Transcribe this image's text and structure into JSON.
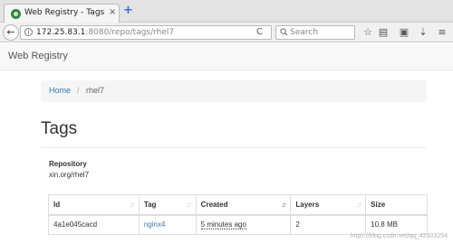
{
  "browser": {
    "tab_title": "Web Registry - Tags",
    "tab_close": "×",
    "new_tab": "+",
    "back": "←",
    "url_host": "172.25.83.1",
    "url_rest": ":8080/repo/tags/rhel7",
    "reload": "C",
    "search_placeholder": "Search",
    "toolbar_icons": [
      "star-icon",
      "reading-list-icon",
      "lock-icon",
      "download-icon",
      "menu-icon"
    ]
  },
  "app": {
    "brand": "Web Registry"
  },
  "breadcrumb": {
    "home": "Home",
    "separator": "/",
    "current": "rhel7"
  },
  "page": {
    "title": "Tags",
    "repository_label": "Repository",
    "repository_value": "xin.org/rhel7"
  },
  "table": {
    "columns": [
      "Id",
      "Tag",
      "Created",
      "Layers",
      "Size"
    ],
    "rows": [
      {
        "id": "4a1e045cacd",
        "tag": "nginx4",
        "created": "5 minutes ago",
        "layers": "2",
        "size": "10.8 MB"
      }
    ]
  },
  "watermark": "https://blog.csdn.net/qq_42303254",
  "colors": {
    "link": "#337ab7",
    "header_bg": "#f8f8f8",
    "breadcrumb_bg": "#f5f5f5"
  }
}
